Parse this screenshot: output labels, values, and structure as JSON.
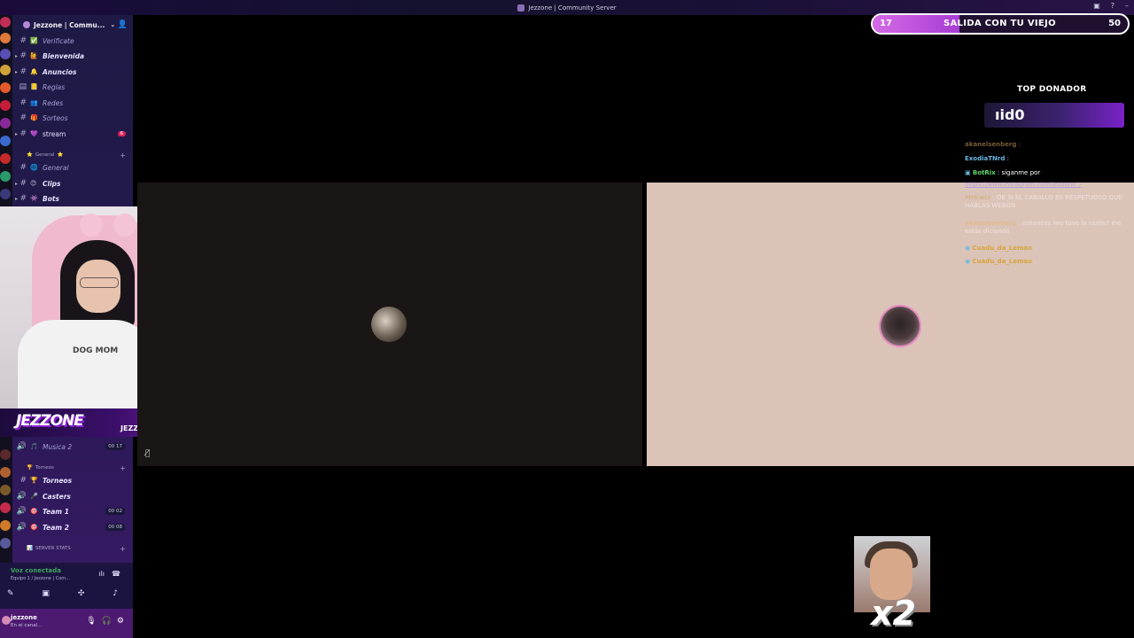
{
  "window": {
    "title": "Jezzone | Community Server"
  },
  "server": {
    "name": "Jezzone | Commu..."
  },
  "channels": [
    {
      "emoji": "✅",
      "name": "Verificate",
      "style": "dim"
    },
    {
      "emoji": "🙋",
      "name": "Bienvenida",
      "style": "bold"
    },
    {
      "emoji": "🔔",
      "name": "Anuncios",
      "style": "bold"
    },
    {
      "emoji": "📒",
      "name": "Reglas",
      "style": "dim"
    },
    {
      "emoji": "👥",
      "name": "Redes",
      "style": "dim"
    },
    {
      "emoji": "🎁",
      "name": "Sorteos",
      "style": "dim"
    },
    {
      "emoji": "💜",
      "name": "stream",
      "style": "plain",
      "badge": "6"
    }
  ],
  "category_general": "General",
  "channels_general": [
    {
      "emoji": "🌐",
      "name": "General",
      "style": "dim"
    },
    {
      "emoji": "😊",
      "name": "Clips",
      "style": "bold"
    },
    {
      "emoji": "👾",
      "name": "Bots",
      "style": "bold"
    }
  ],
  "voice_musica": {
    "name": "Musica 2",
    "count_a": "00",
    "count_b": "17"
  },
  "category_torneos": "Torneos",
  "channels_torneos": [
    {
      "emoji": "🏆",
      "name": "Torneos"
    },
    {
      "emoji": "🎤",
      "name": "Casters"
    }
  ],
  "teams": [
    {
      "name": "Team 1",
      "count_a": "00",
      "count_b": "02"
    },
    {
      "name": "Team 2",
      "count_a": "00",
      "count_b": "08"
    }
  ],
  "server_stats": "SERVER STATS",
  "voice": {
    "status": "Voz conectada",
    "sub": "Equipo 1 / Jezzone | Com..."
  },
  "user": {
    "name": "jezzone",
    "sub": "En el canal..."
  },
  "brand": {
    "logo": "JEZZONE",
    "twitch": "JEZZONE_"
  },
  "webcam": {
    "shirt_text": "DOG MOM"
  },
  "goal": {
    "start": "17",
    "title": "SALIDA CON TU VIEJO",
    "end": "50",
    "progress": 0.34
  },
  "top_donor": {
    "label": "TOP DONADOR",
    "name": "ıid0"
  },
  "chat": [
    {
      "user": "akanelsenberg",
      "text": "",
      "color": "#e3b26a",
      "faded": true
    },
    {
      "user": "ExodiaTNrd",
      "text": "",
      "color": "#6ab9e3",
      "faded": false
    },
    {
      "user": "BotRix",
      "text": "síganme por",
      "color": "#5fd36b",
      "faded": false
    },
    {
      "user": "",
      "text": "https://www.instagram.com/jezzone_/",
      "color": "#8a7cff",
      "faded": true
    },
    {
      "user": "MrKwix",
      "text": "OE SI EL CABALLO ES RESPETUOSO QUE HABLAS WEBON",
      "color": "#c7a96b",
      "faded": true
    },
    {
      "user": "akanelsenberg",
      "text": "entonces iwo tuvo la razón? me estás diciendo",
      "color": "#e3b26a",
      "faded": true
    },
    {
      "user": "Cuadu_da_Lemao",
      "text": "",
      "color": "#d6a53a",
      "faded": false
    },
    {
      "user": "Cuadu_da_Lemao",
      "text": "",
      "color": "#d6a53a",
      "faded": false
    }
  ],
  "multiplier": "x2",
  "colors": {
    "accent": "#a73dd4",
    "mention": "#e0245e"
  }
}
